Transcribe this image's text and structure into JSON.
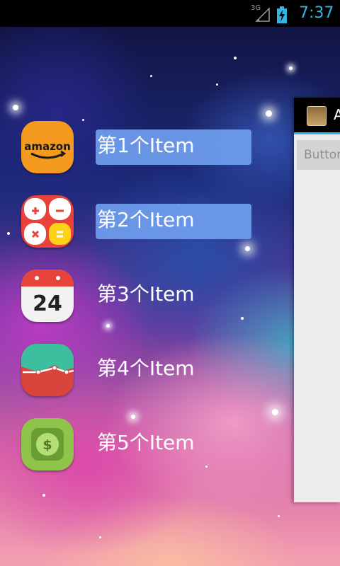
{
  "status_bar": {
    "network": "3G",
    "time": "7:37"
  },
  "menu": {
    "items": [
      {
        "label": "第1个Item",
        "icon": "amazon-icon",
        "selected": true
      },
      {
        "label": "第2个Item",
        "icon": "calculator-icon",
        "selected": true
      },
      {
        "label": "第3个Item",
        "icon": "calendar-icon",
        "selected": false
      },
      {
        "label": "第4个Item",
        "icon": "chart-icon",
        "selected": false
      },
      {
        "label": "第5个Item",
        "icon": "money-icon",
        "selected": false
      }
    ],
    "icon_texts": {
      "amazon": "amazon",
      "calendar_day": "24",
      "money": "$"
    }
  },
  "right_panel": {
    "title": "A",
    "button_label": "Button"
  },
  "colors": {
    "accent": "#33b5e5",
    "selection": "#6e9beb"
  }
}
